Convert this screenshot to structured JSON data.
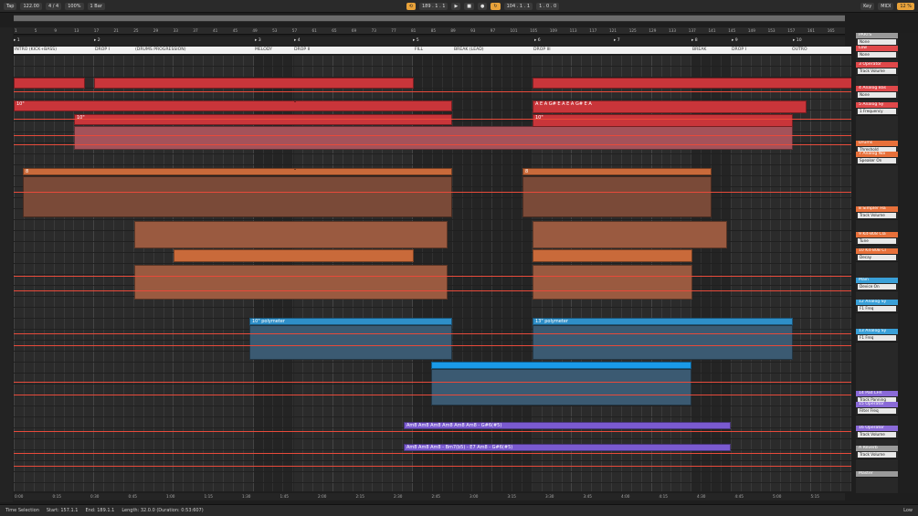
{
  "transport": {
    "tap": "Tap",
    "tempo": "122.00",
    "time_sig": "4 / 4",
    "zoom": "100%",
    "quantize": "1 Bar",
    "position": "189 . 1 . 1",
    "loop_start": "104 . 1 . 1",
    "loop_len": "1 . 0 . 0",
    "key_label": "Key",
    "midi_label": "MIDI",
    "cpu": "12 %"
  },
  "markers": [
    {
      "label": "1"
    },
    {
      "label": "2"
    },
    {
      "label": "3"
    },
    {
      "label": "4"
    },
    {
      "label": "5"
    },
    {
      "label": "6"
    },
    {
      "label": "7"
    },
    {
      "label": "8"
    },
    {
      "label": "9"
    },
    {
      "label": "10"
    }
  ],
  "sections": [
    {
      "label": "INTRO (KICK+BASS)"
    },
    {
      "label": "DROP I"
    },
    {
      "label": "(DRUMS PROGRESSION)"
    },
    {
      "label": "MELODY"
    },
    {
      "label": "DROP II"
    },
    {
      "label": "FILL"
    },
    {
      "label": "BREAK (LEAD)"
    },
    {
      "label": "DROP III"
    },
    {
      "label": "BREAK"
    },
    {
      "label": "DROP I"
    },
    {
      "label": "OUTRO"
    }
  ],
  "beat_ticks": [
    "1",
    "5",
    "9",
    "13",
    "17",
    "21",
    "25",
    "29",
    "33",
    "37",
    "41",
    "45",
    "49",
    "53",
    "57",
    "61",
    "65",
    "69",
    "73",
    "77",
    "81",
    "85",
    "89",
    "93",
    "97",
    "101",
    "105",
    "109",
    "113",
    "117",
    "121",
    "125",
    "129",
    "133",
    "137",
    "141",
    "145",
    "149",
    "153",
    "157",
    "161",
    "165"
  ],
  "time_ticks": [
    "0:00",
    "0:15",
    "0:30",
    "0:45",
    "1:00",
    "1:15",
    "1:30",
    "1:45",
    "2:00",
    "2:15",
    "2:30",
    "2:45",
    "3:00",
    "3:15",
    "3:30",
    "3:45",
    "4:00",
    "4:15",
    "4:30",
    "4:45",
    "5:00",
    "5:15"
  ],
  "clip_labels": {
    "bass_a": "10\"",
    "bass_b": "10\"",
    "bass_c": "10\"",
    "bass_d": "10\"",
    "drum_a": "8",
    "drum_b": "8",
    "drum_c": "8",
    "poly_a": "10\" polymeter",
    "poly_b": "13\" polymeter",
    "notes": "A   E   A   G# E   A     E   A   G# E   A",
    "chords_a": "Am8       Am8          Am8  Am8  Am8   Am8 - G#6(#5)",
    "chords_b": "Am8 - Bm7(b5) - E7    Am8 - G#6(#5)   Am8 - Bm7(b5) - E7   Am8 - G#6(#5)   Am8",
    "chords_c": "Am8        Am8 Am8 - Bm7(b5) - E7   Am8 - G#6(#5)",
    "chords_d": "Am8 - Bm7(b5) - E7   Am8 - G#6(#5)   Am8 - Bm7(b5) - E7   Am8 - G#6(#5)   Am8"
  },
  "mixer": {
    "tracks": [
      {
        "name": "PARTS",
        "dd": "None",
        "color": "#9a9a9a"
      },
      {
        "name": "Low",
        "dd": "None",
        "color": "#e0484a"
      },
      {
        "name": "3 Operator",
        "dd": "Track Volume",
        "color": "#e0484a"
      },
      {
        "name": "4 Analog Bas",
        "dd": "None",
        "color": "#e0484a"
      },
      {
        "name": "5 Analog Sy",
        "dd": "1 Frequency",
        "color": "#e0484a"
      },
      {
        "name": "Drums",
        "dd": "Threshold",
        "color": "#e8703a"
      },
      {
        "name": "7 Analog Noi",
        "dd": "Speaker On",
        "color": "#e8703a"
      },
      {
        "name": "8 Simpler Ha",
        "dd": "Track Volume",
        "color": "#e8703a"
      },
      {
        "name": "9 Kit-808 Cla",
        "dd": "Tune",
        "color": "#e8703a"
      },
      {
        "name": "10 Kit-808 Cl",
        "dd": "Decay",
        "color": "#e8703a"
      },
      {
        "name": "Main",
        "dd": "Device On",
        "color": "#3aa0d8"
      },
      {
        "name": "12 Analog Sy",
        "dd": "F1 Freq",
        "color": "#3aa0d8"
      },
      {
        "name": "13 Analog Sy",
        "dd": "F1 Freq",
        "color": "#3aa0d8"
      },
      {
        "name": "14 Pad LFR",
        "dd": "Track Panning",
        "color": "#8a6ad8"
      },
      {
        "name": "15 Operator",
        "dd": "Filter Freq",
        "color": "#8a6ad8"
      },
      {
        "name": "16 Operator",
        "dd": "Track Volume",
        "color": "#8a6ad8"
      },
      {
        "name": "A Reverb",
        "dd": "Track Volume",
        "color": "#9a9a9a"
      },
      {
        "name": "Master",
        "dd": "",
        "color": "#9a9a9a"
      }
    ]
  },
  "status": {
    "label": "Time Selection",
    "start": "Start: 157.1.1",
    "end": "End: 189.1.1",
    "length": "Length: 32.0.0 (Duration: 0:53:607)",
    "right": "Low"
  }
}
